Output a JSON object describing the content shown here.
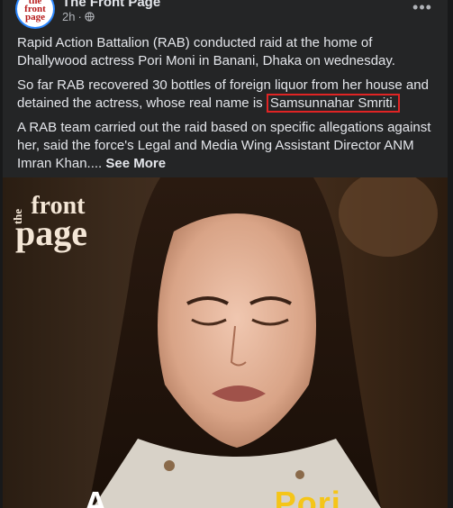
{
  "post": {
    "page_name": "The Front Page",
    "avatar_text": "the front page",
    "time": "2h",
    "more_label": "•••",
    "paragraphs": [
      {
        "text": "Rapid Action Battalion (RAB) conducted raid at the home of Dhallywood actress Pori Moni in Banani, Dhaka on wednesday."
      },
      {
        "before": "So far RAB recovered 30 bottles of foreign liquor from her house and detained the actress, whose real name is ",
        "highlight": "Samsunnahar Smriti."
      },
      {
        "text": "A RAB team carried out the raid based on specific allegations against her, said the force's Legal and Media Wing Assistant Director ANM Imran Khan....",
        "see_more": "See More"
      }
    ]
  },
  "photo": {
    "brand_small": "the",
    "brand_line1": "front",
    "brand_line2": "page",
    "overlay_left": "A",
    "overlay_right": "Pori",
    "overlay_left_color": "#ffffff",
    "overlay_right_color": "#f5c518"
  },
  "colors": {
    "highlight_border": "#e02424",
    "avatar_ring": "#2d88ff"
  }
}
